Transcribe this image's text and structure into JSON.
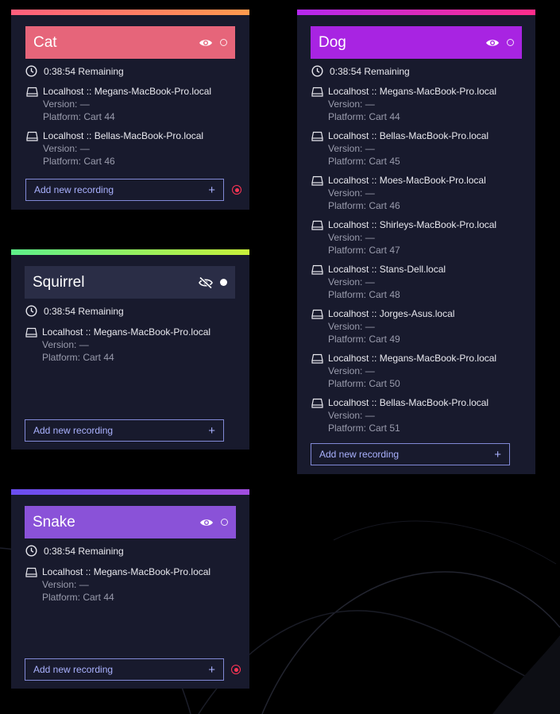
{
  "colors": {
    "card_bg": "#181a2d",
    "record_accent": "#ff3555",
    "button_border": "#8189d6"
  },
  "cards": {
    "cat": {
      "title": "Cat",
      "remaining": "0:38:54 Remaining",
      "visible": true,
      "status_dot": "hollow",
      "accent_gradient": [
        "#ff5e7d",
        "#ff9a4d"
      ],
      "header_color": "#e6657a",
      "devices": [
        {
          "host": "Localhost :: Megans-MacBook-Pro.local",
          "version": "Version: —",
          "platform": "Platform: Cart 44"
        },
        {
          "host": "Localhost :: Bellas-MacBook-Pro.local",
          "version": "Version: —",
          "platform": "Platform: Cart 46"
        }
      ],
      "add_label": "Add new recording",
      "add_icon": "+",
      "record_button": true
    },
    "dog": {
      "title": "Dog",
      "remaining": "0:38:54 Remaining",
      "visible": true,
      "status_dot": "hollow",
      "accent_gradient": [
        "#b428f0",
        "#ff2d8a"
      ],
      "header_color": "#a824e2",
      "devices": [
        {
          "host": "Localhost :: Megans-MacBook-Pro.local",
          "version": "Version: —",
          "platform": "Platform: Cart 44"
        },
        {
          "host": "Localhost :: Bellas-MacBook-Pro.local",
          "version": "Version: —",
          "platform": "Platform: Cart 45"
        },
        {
          "host": "Localhost :: Moes-MacBook-Pro.local",
          "version": "Version: —",
          "platform": "Platform: Cart 46"
        },
        {
          "host": "Localhost :: Shirleys-MacBook-Pro.local",
          "version": "Version: —",
          "platform": "Platform: Cart 47"
        },
        {
          "host": "Localhost :: Stans-Dell.local",
          "version": "Version: —",
          "platform": "Platform: Cart 48"
        },
        {
          "host": "Localhost :: Jorges-Asus.local",
          "version": "Version: —",
          "platform": "Platform: Cart 49"
        },
        {
          "host": "Localhost :: Megans-MacBook-Pro.local",
          "version": "Version: —",
          "platform": "Platform: Cart 50"
        },
        {
          "host": "Localhost :: Bellas-MacBook-Pro.local",
          "version": "Version: —",
          "platform": "Platform: Cart 51"
        }
      ],
      "add_label": "Add new recording",
      "add_icon": "+",
      "record_button": false
    },
    "squirrel": {
      "title": "Squirrel",
      "remaining": "0:38:54 Remaining",
      "visible": false,
      "status_dot": "filled",
      "accent_gradient": [
        "#5ef08a",
        "#c8f03a"
      ],
      "header_color": "#2a2d46",
      "devices": [
        {
          "host": "Localhost :: Megans-MacBook-Pro.local",
          "version": "Version: —",
          "platform": "Platform: Cart 44"
        }
      ],
      "add_label": "Add new recording",
      "add_icon": "+",
      "record_button": false
    },
    "snake": {
      "title": "Snake",
      "remaining": "0:38:54 Remaining",
      "visible": true,
      "status_dot": "hollow",
      "accent_gradient": [
        "#6a4ef0",
        "#a24ee0"
      ],
      "header_color": "#8a52d8",
      "devices": [
        {
          "host": "Localhost :: Megans-MacBook-Pro.local",
          "version": "Version: —",
          "platform": "Platform: Cart 44"
        }
      ],
      "add_label": "Add new recording",
      "add_icon": "+",
      "record_button": true
    }
  }
}
